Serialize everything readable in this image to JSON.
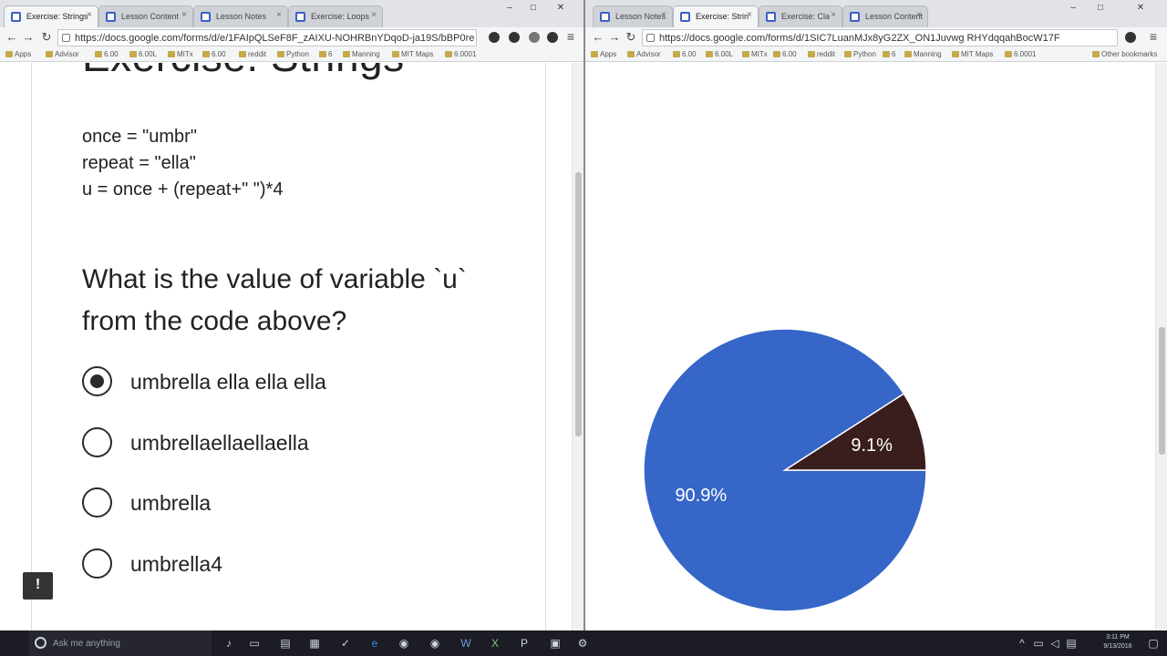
{
  "left_window": {
    "tabs": [
      {
        "label": "Exercise: Strings",
        "active": true
      },
      {
        "label": "Lesson Content",
        "active": false
      },
      {
        "label": "Lesson Notes",
        "active": false
      },
      {
        "label": "Exercise: Loops",
        "active": false
      }
    ],
    "url": "https://docs.google.com/forms/d/e/1FAIpQLSeF8F_zAIXU-NOHRBnYDqoD-ja19S/bBP0re",
    "bookmarks": [
      "Apps",
      "Advisor",
      "6.00",
      "6.00L",
      "MITx",
      "6.00",
      "reddit",
      "Python",
      "6",
      "Manning",
      "MIT Maps",
      "6.0001"
    ]
  },
  "right_window": {
    "tabs": [
      {
        "label": "Lesson Notes",
        "active": false
      },
      {
        "label": "Exercise: Strin",
        "active": true
      },
      {
        "label": "Exercise: Cla",
        "active": false
      },
      {
        "label": "Lesson Content",
        "active": false
      }
    ],
    "url": "https://docs.google.com/forms/d/1SIC7LuanMJx8yG2ZX_ON1Juvwg RHYdqqahBocW17F",
    "bookmarks": [
      "Apps",
      "Advisor",
      "6.00",
      "6.00L",
      "MITx",
      "6.00",
      "reddit",
      "Python",
      "6",
      "Manning",
      "MIT Maps",
      "6.0001",
      "Other bookmarks"
    ]
  },
  "form": {
    "title": "Exercise: Strings",
    "code_lines": [
      "once = \"umbr\"",
      "repeat = \"ella\"",
      "u = once + (repeat+\" \")*4"
    ],
    "question": "What is the value of variable `u` from the code above?",
    "options": [
      {
        "label": "umbrella ella ella ella",
        "selected": true
      },
      {
        "label": "umbrellaellaellaella",
        "selected": false
      },
      {
        "label": "umbrella",
        "selected": false
      },
      {
        "label": "umbrella4",
        "selected": false
      }
    ],
    "feedback_icon": "!"
  },
  "chart_data": {
    "type": "pie",
    "title": "",
    "slices": [
      {
        "label": "90.9%",
        "value": 90.9,
        "color": "#3566c8"
      },
      {
        "label": "9.1%",
        "value": 9.1,
        "color": "#3a1d1d"
      }
    ]
  },
  "taskbar": {
    "search_placeholder": "Ask me anything",
    "time": "3:11 PM",
    "date": "9/13/2016"
  },
  "colors": {
    "accent": "#3566c8",
    "taskbar": "#1c1c24",
    "secondary_slice": "#3a1d1d"
  }
}
